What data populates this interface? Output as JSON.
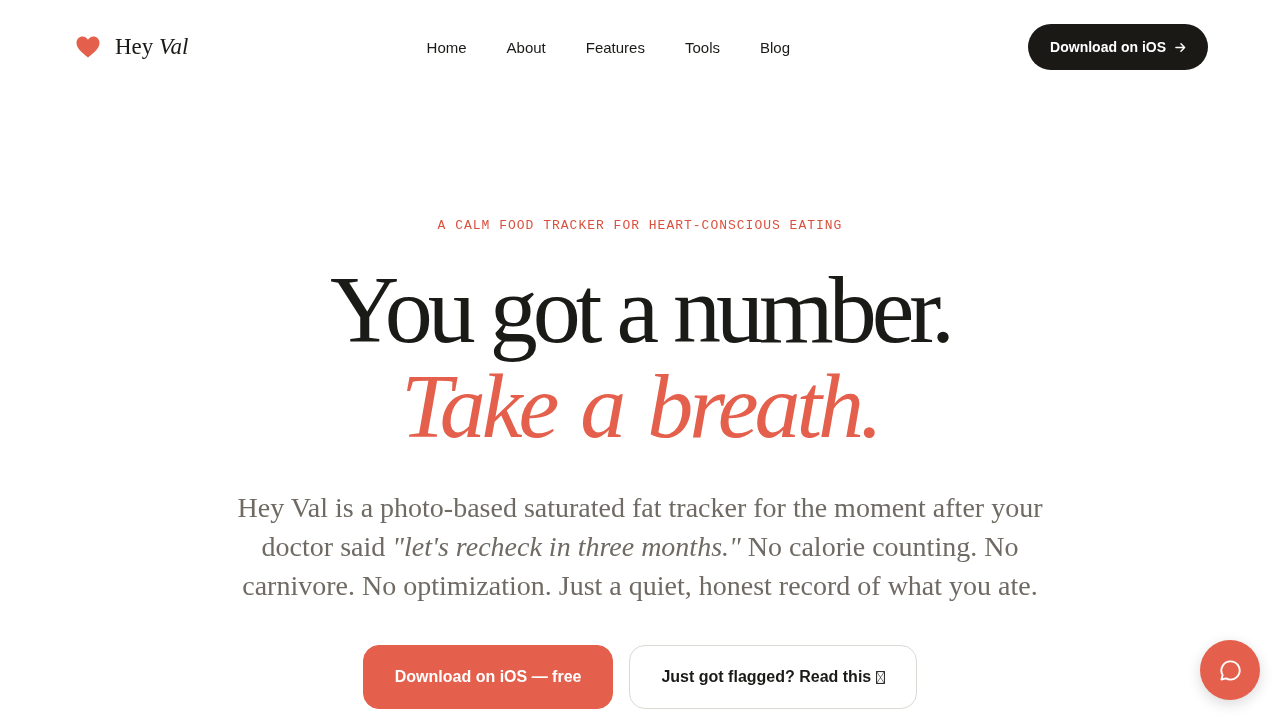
{
  "header": {
    "logo": "Hey *Val*",
    "nav": [
      {
        "label": "Home"
      },
      {
        "label": "About"
      },
      {
        "label": "Features"
      },
      {
        "label": "Tools"
      },
      {
        "label": "Blog"
      }
    ],
    "cta": {
      "label": "Download on iOS"
    }
  },
  "hero": {
    "eyebrow": "A CALM FOOD TRACKER FOR HEART-CONSCIOUS EATING",
    "headline": "You got a number.",
    "headline_accent": "Take a breath.",
    "description": "Hey Val is a photo-based saturated fat tracker for the moment after your doctor said *\"let's recheck in three months.\"* No calorie counting. No carnivore. No optimization. Just a quiet, honest record of what you ate.",
    "buttons": [
      {
        "label": "Download on iOS — free",
        "kind": "primary"
      },
      {
        "label": "Just got flagged? Read this",
        "kind": "secondary"
      }
    ]
  }
}
